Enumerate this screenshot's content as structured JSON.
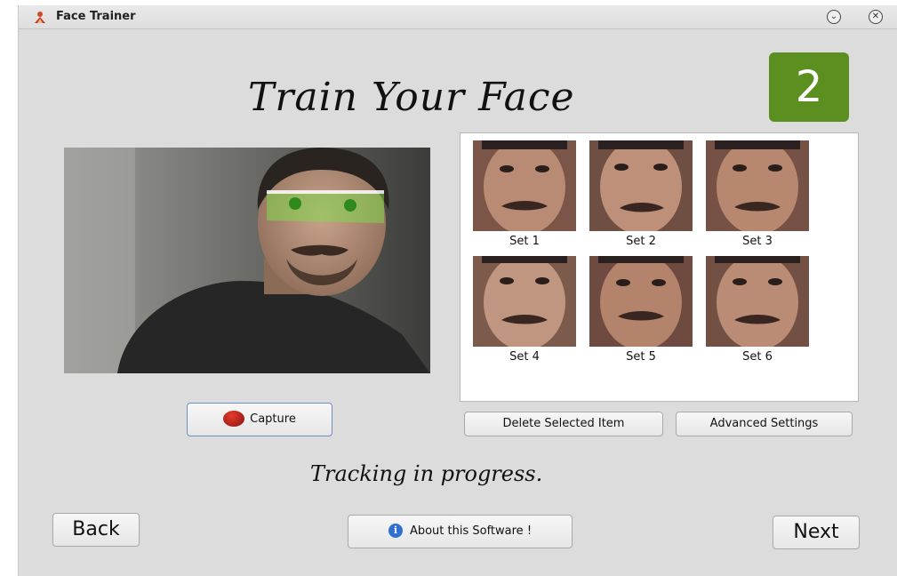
{
  "window": {
    "title": "Face Trainer",
    "minimize_glyph": "⌄",
    "close_glyph": "✕"
  },
  "header": {
    "title": "Train Your Face",
    "step_number": "2"
  },
  "gallery": {
    "items": [
      {
        "label": "Set 1"
      },
      {
        "label": "Set 2"
      },
      {
        "label": "Set 3"
      },
      {
        "label": "Set 4"
      },
      {
        "label": "Set 5"
      },
      {
        "label": "Set 6"
      }
    ]
  },
  "buttons": {
    "capture": "Capture",
    "delete": "Delete Selected Item",
    "advanced": "Advanced Settings",
    "back": "Back",
    "about": "About this Software !",
    "next": "Next"
  },
  "status": {
    "text": "Tracking in progress."
  },
  "colors": {
    "step_badge": "#5b8f1f",
    "window_bg": "#dcdcdc",
    "capture_icon": "#c0211a",
    "info_icon": "#2f6fcf",
    "tracking_overlay": "#7fd84a"
  },
  "icons": {
    "app": "face-trainer-app-icon",
    "capture": "record-dot-icon",
    "about": "info-icon"
  }
}
